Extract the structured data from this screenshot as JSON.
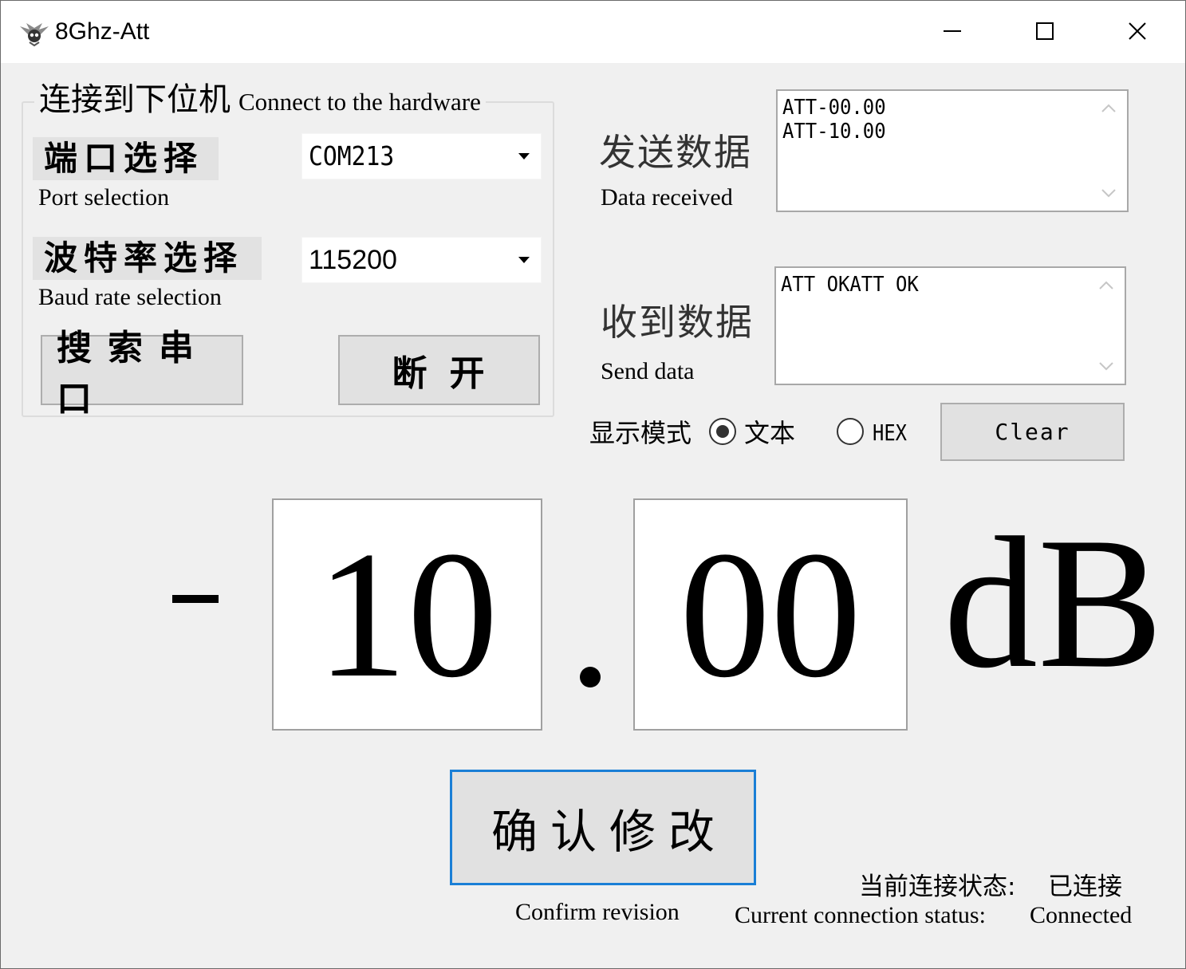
{
  "window": {
    "title": "8Ghz-Att",
    "icon": "app-icon",
    "controls": [
      "minimize-icon",
      "maximize-icon",
      "close-icon"
    ]
  },
  "connection_group": {
    "title_cn": "连接到下位机",
    "title_en": "Connect to the  hardware",
    "port_label_cn": "端口选择",
    "port_label_en": "Port selection",
    "port_value": "COM213",
    "baud_label_cn": "波特率选择",
    "baud_label_en": "Baud rate selection",
    "baud_value": "115200",
    "search_button": "搜索串口",
    "disconnect_button": "断开"
  },
  "send_panel": {
    "label_cn": "发送数据",
    "label_en": "Data received",
    "content": "ATT-00.00\nATT-10.00"
  },
  "receive_panel": {
    "label_cn": "收到数据",
    "label_en": "Send data",
    "content": "ATT OKATT OK"
  },
  "display_mode": {
    "label": "显示模式",
    "options": [
      "文本",
      "HEX"
    ],
    "selected": "文本",
    "clear_button": "Clear"
  },
  "attenuation": {
    "sign": "-",
    "integer": "10",
    "decimal": "00",
    "unit": "dB"
  },
  "confirm": {
    "button": "确认修改",
    "caption": "Confirm revision"
  },
  "status": {
    "label_cn": "当前连接状态:",
    "value_cn": "已连接",
    "label_en": "Current connection status:",
    "value_en": "Connected"
  }
}
